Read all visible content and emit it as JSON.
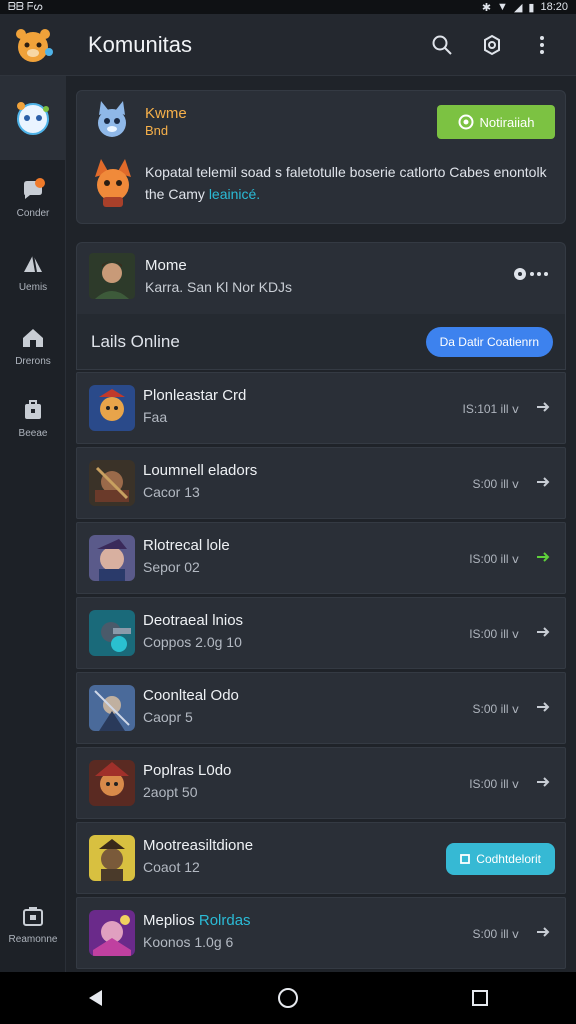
{
  "status_bar": {
    "left": "ᗷᗷ  ᖴᔕ",
    "time": "18:20"
  },
  "app_bar": {
    "title": "Komunitas"
  },
  "sidebar": {
    "items": [
      {
        "label": "Conder",
        "badge": "3"
      },
      {
        "label": "Uemis"
      },
      {
        "label": "Drerons"
      },
      {
        "label": "Beeae"
      },
      {
        "label": "Reamonne"
      }
    ]
  },
  "hero": {
    "name": "Kwme",
    "sub": "Bnd",
    "notify_label": "Notiraiiah",
    "text_main": "Kopatal telemil soad s faletotulle boserie catlorto Cabes enontolk the Camy",
    "text_link": "leainicé."
  },
  "user": {
    "name": "Mome",
    "meta": "Karra. San Kl Nor KDJs"
  },
  "online": {
    "title": "Lails Online",
    "button": "Da Datir Coatienrn"
  },
  "list": [
    {
      "title": "Plonleastar Crd",
      "sub": "Faa",
      "meta": "IS:101 ill ⅴ"
    },
    {
      "title": "Loumnell eladors",
      "sub": "Cacor 13",
      "meta": "S:00 ill ⅴ"
    },
    {
      "title": "Rlotrecal lole",
      "sub": "Sepor 02",
      "meta": "IS:00 ill ⅴ",
      "arrow_color": "#5ed13a"
    },
    {
      "title": "Deotraeal lnios",
      "sub": "Coppos 2.0g 10",
      "meta": "IS:00 ill ⅴ"
    },
    {
      "title": "Coonlteal Odo",
      "sub": "Caopr 5",
      "meta": "S:00 ill ⅴ"
    },
    {
      "title": "Poplras L0do",
      "sub": "2aopt 50",
      "meta": "IS:00 ill ⅴ"
    },
    {
      "title": "Mootreasiltdione",
      "sub": "Coaot 12",
      "button": "Codhtdelorit"
    },
    {
      "title": "Meplios",
      "title_accent": "Rolrdas",
      "sub": "Koonos 1.0g 6",
      "meta": "S:00 ill ⅴ"
    }
  ],
  "colors": {
    "accent_green": "#7cc242",
    "accent_blue": "#3d82ee",
    "accent_teal": "#36b9d4",
    "accent_orange": "#f6b04a"
  }
}
